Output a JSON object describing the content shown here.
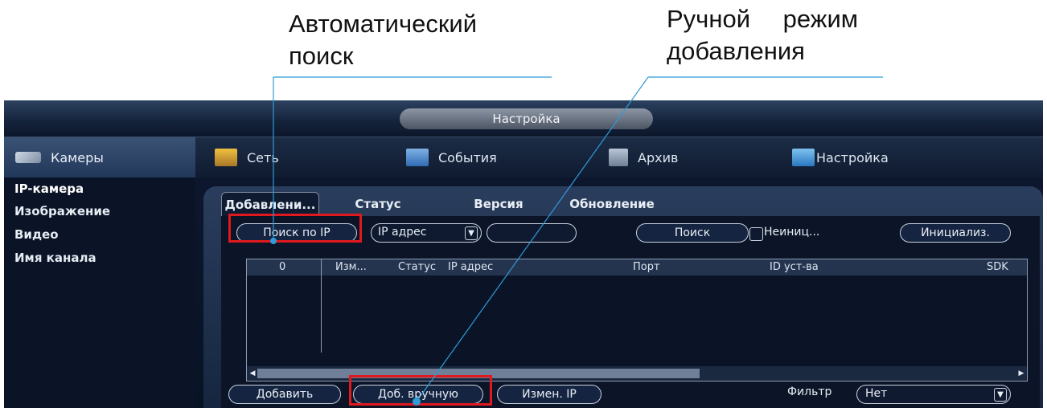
{
  "annotations": {
    "auto_search": [
      "Автоматический",
      "поиск"
    ],
    "manual_add": [
      "Ручной режим",
      "добавления"
    ]
  },
  "window": {
    "title": "Настройка"
  },
  "nav": {
    "cameras": "Камеры",
    "network": "Сеть",
    "events": "События",
    "archive": "Архив",
    "settings": "Настройка"
  },
  "sidebar": [
    "IP-камера",
    "Изображение",
    "Видео",
    "Имя канала"
  ],
  "tabs": [
    "Добавлени...",
    "Статус",
    "Версия",
    "Обновление"
  ],
  "toolbar": {
    "search_ip": "Поиск по IP",
    "ip_select": "IP адрес",
    "search": "Поиск",
    "uninit": "Неиниц...",
    "initialize": "Инициализ."
  },
  "table": {
    "count": "0",
    "columns": [
      "Изм...",
      "Статус",
      "IP адрес",
      "Порт",
      "ID уст-ва",
      "SDK"
    ],
    "rows": []
  },
  "bottom": {
    "add": "Добавить",
    "add_manual": "Доб. вручную",
    "change_ip": "Измен. IP",
    "filter_label": "Фильтр",
    "filter_value": "Нет"
  },
  "colors": {
    "highlight": "#e0191e",
    "callout_line": "#2f9bd8"
  }
}
